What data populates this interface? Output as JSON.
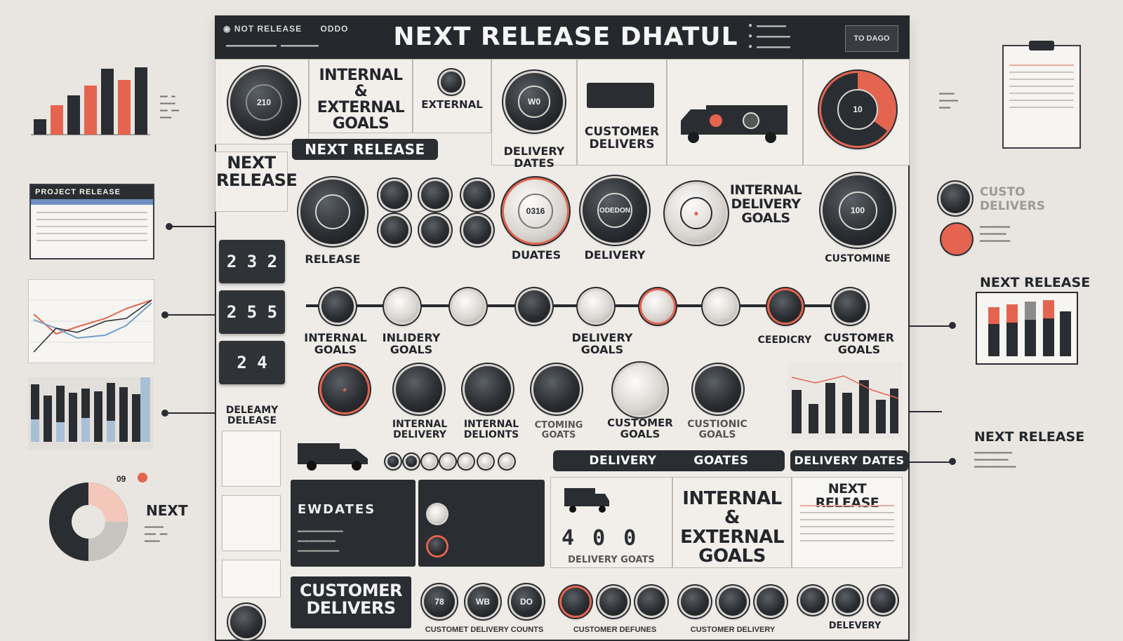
{
  "header": {
    "left_title": "NOT RELEASE",
    "left_code": "ODDO",
    "title": "NEXT RELEASE DHATUL",
    "button": "TO DAGO"
  },
  "top_row": {
    "clock_value": "210",
    "goals_title": "INTERNAL & EXTERNAL GOALS",
    "external": "EXTERNAL",
    "next_release_pill": "NEXT RELEASE",
    "delivery_dates": "DELIVERY DATES",
    "knob_value": "W0",
    "customer_delivers": "CUSTOMER DELIVERS",
    "red_knob_value": "10"
  },
  "left_column": {
    "next_release": "NEXT RELEASE",
    "counters": [
      "2 3 2",
      "2 5 5",
      "2 4"
    ],
    "delemy_delease": "DELEAMY DELEASE"
  },
  "middle_row": {
    "release": "RELEASE",
    "dials": [
      "0316",
      "ODEDON"
    ],
    "duates": "DUATES",
    "delivery": "DELIVERY",
    "internal_delivery_goals": "INTERNAL DELIVERY GOALS",
    "target_value": "100",
    "customine": "CUSTOMINE"
  },
  "timeline_labels": [
    "INTERNAL GOALS",
    "INLIDERY GOALS",
    "DELIVERY GOALS",
    "CEEDICRY",
    "CUSTOMER GOALS"
  ],
  "lower_labels": [
    "INTERNAL DELIVERY",
    "INTERNAL DELIONTS",
    "CTOMING GOATS",
    "CUSTOMER GOALS",
    "CUSTIONIC GOALS"
  ],
  "strip": {
    "delivery": "DELIVERY",
    "goates": "GOATES",
    "delivery_dates": "DELIVERY DATES"
  },
  "bottom": {
    "ewdates": "EWDATES",
    "digits": "4 0 0",
    "delivery_goats": "DELIVERY GOATS",
    "goals_title": "INTERNAL & EXTERNAL GOALS",
    "next_release": "NEXT RELEASE",
    "customer_delivers": "CUSTOMER DELIVERS",
    "knobs": [
      "78",
      "WB",
      "DO"
    ],
    "customet_delivery": "CUSTOMET DELIVERY COUNTS",
    "customer_defunes": "CUSTOMER DEFUNES",
    "customer_delivery": "CUSTOMER DELIVERY",
    "delevery": "DELEVERY"
  },
  "sidebar_left": {
    "project_release": "PROJECT RELEASE",
    "next": "NEXT",
    "small_counts": "09"
  },
  "sidebar_right": {
    "custom_delivers": "CUSTO DELIVERS",
    "next_release_1": "NEXT RELEASE",
    "next_release_2": "NEXT RELEASE"
  },
  "colors": {
    "dark": "#2a2d31",
    "accent": "#e4644f",
    "board": "#efece8",
    "paper": "#e9e5e0"
  }
}
